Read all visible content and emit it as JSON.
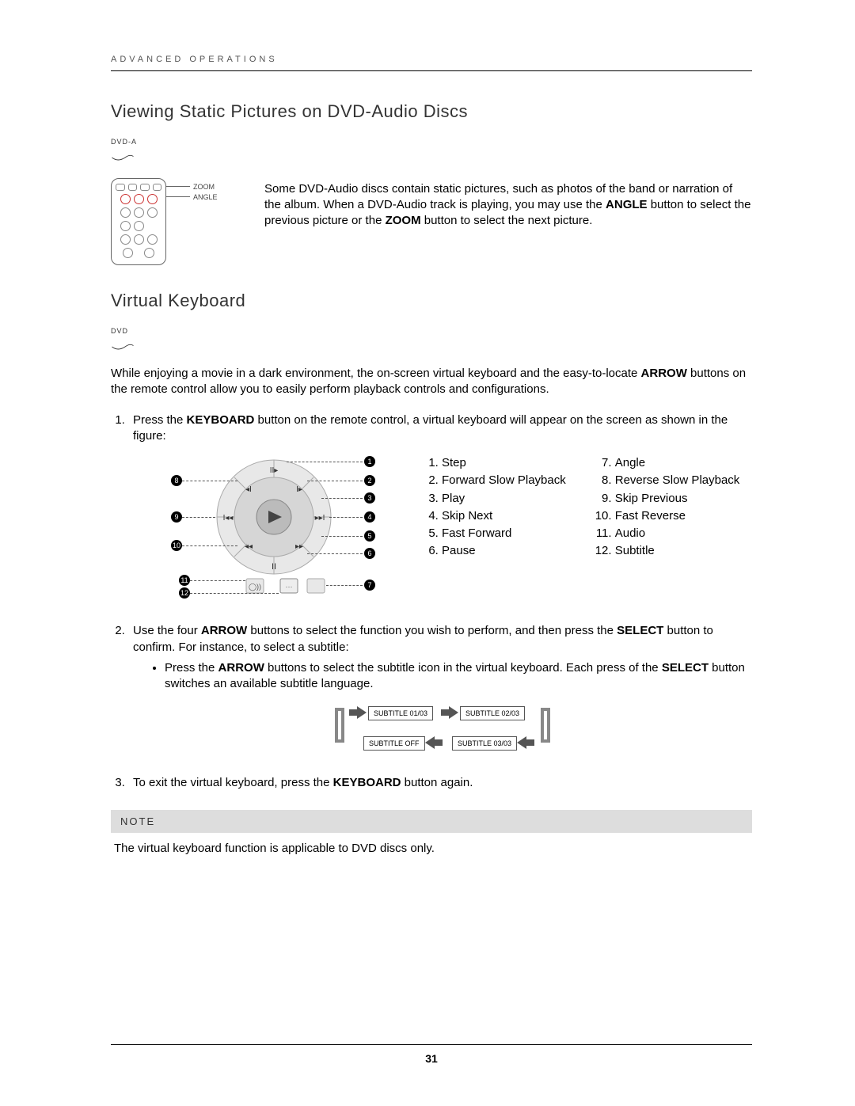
{
  "header": "ADVANCED OPERATIONS",
  "section1": {
    "title": "Viewing Static Pictures on DVD-Audio Discs",
    "badge": "DVD-A",
    "labels": {
      "zoom": "ZOOM",
      "angle": "ANGLE"
    },
    "text_parts": [
      "Some DVD-Audio discs contain static pictures, such as photos of the band or narration of the album.  When a DVD-Audio track is playing, you may use the ",
      "ANGLE",
      " button to select the previous picture or the ",
      "ZOOM",
      " button to select the next picture."
    ]
  },
  "section2": {
    "title": "Virtual Keyboard",
    "badge": "DVD",
    "intro_parts": [
      "While enjoying a movie in a dark environment, the on-screen virtual keyboard and the easy-to-locate ",
      "ARROW",
      " buttons on the remote control allow you to easily perform playback controls and configurations."
    ],
    "step1_parts": [
      "Press the ",
      "KEYBOARD",
      " button on the remote control, a virtual keyboard will appear on the screen as shown in the figure:"
    ],
    "legend_left": [
      "Step",
      "Forward Slow Playback",
      "Play",
      "Skip Next",
      "Fast Forward",
      "Pause"
    ],
    "legend_right": [
      "Angle",
      "Reverse Slow Playback",
      "Skip Previous",
      "Fast Reverse",
      "Audio",
      "Subtitle"
    ],
    "step2_parts": [
      "Use the four ",
      "ARROW",
      " buttons to select the function you wish to perform, and then press the ",
      "SELECT",
      " button to confirm.  For instance, to select a subtitle:"
    ],
    "step2_bullet_parts": [
      "Press the ",
      "ARROW",
      " buttons to select the subtitle icon in the virtual keyboard.  Each press of the ",
      "SELECT",
      " button switches an available subtitle language."
    ],
    "subtitle_cycle": [
      "SUBTITLE 01/03",
      "SUBTITLE 02/03",
      "SUBTITLE OFF",
      "SUBTITLE 03/03"
    ],
    "step3_parts": [
      "To exit the virtual keyboard, press the ",
      "KEYBOARD",
      " button again."
    ]
  },
  "note": {
    "title": "NOTE",
    "body": "The virtual keyboard function is applicable to DVD discs only."
  },
  "page_number": "31"
}
